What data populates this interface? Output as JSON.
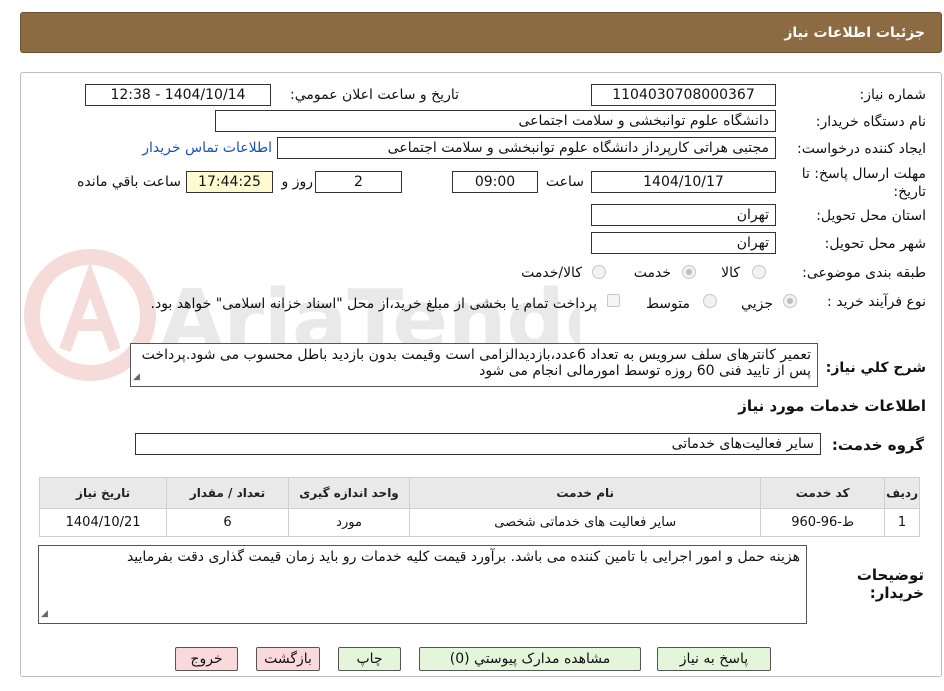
{
  "header": {
    "title": "جزئیات اطلاعات نیاز"
  },
  "form": {
    "need_number_label": "شماره نیاز:",
    "need_number": "1104030708000367",
    "announce_label": "تاریخ و ساعت اعلان عمومي:",
    "announce_value": "1404/10/14 - 12:38",
    "buyer_org_label": "نام دستگاه خریدار:",
    "buyer_org": "دانشگاه علوم توانبخشی و سلامت اجتماعی",
    "creator_label": "ایجاد کننده درخواست:",
    "creator": "مجتبی هراتی کارپرداز دانشگاه علوم توانبخشی و سلامت اجتماعی",
    "contact_link": "اطلاعات تماس خریدار",
    "deadline_label": "مهلت ارسال پاسخ: تا تاریخ:",
    "deadline_date": "1404/10/17",
    "time_label": "ساعت",
    "deadline_time": "09:00",
    "days_value": "2",
    "days_label": "روز و",
    "remaining_time": "17:44:25",
    "remaining_label": "ساعت باقي مانده",
    "province_label": "استان محل تحویل:",
    "province": "تهران",
    "city_label": "شهر محل تحویل:",
    "city": "تهران",
    "category_label": "طبقه بندی موضوعی:",
    "category_options": [
      "کالا",
      "خدمت",
      "کالا/خدمت"
    ],
    "category_selected": "خدمت",
    "process_label": "نوع فرآیند خرید :",
    "process_options": [
      "جزیي",
      "متوسط"
    ],
    "process_selected": "جزیي",
    "treasury_text": "پرداخت تمام یا بخشی از مبلغ خرید،از محل \"اسناد خزانه اسلامی\" خواهد بود.",
    "description_label": "شرح کلي نیاز:",
    "description": "تعمیر کانترهای سلف سرویس به تعداد 6عدد،بازدیدالزامی است وقیمت بدون بازدید باطل محسوب می شود.پرداخت پس از تایید فنی 60 روزه توسط امورمالی انجام می شود"
  },
  "services": {
    "section_title": "اطلاعات خدمات مورد نیاز",
    "group_label": "گروه خدمت:",
    "group_value": "سایر فعالیت‌های خدماتی",
    "columns": [
      "ردیف",
      "کد خدمت",
      "نام خدمت",
      "واحد اندازه گیری",
      "تعداد / مقدار",
      "تاریخ نیاز"
    ],
    "rows": [
      {
        "row": "1",
        "code": "ط-96-960",
        "name": "سایر فعالیت های خدماتی شخصی",
        "unit": "مورد",
        "qty": "6",
        "date": "1404/10/21"
      }
    ]
  },
  "notes": {
    "label": "توضیحات خریدار:",
    "text": "هزینه حمل و امور اجرایی با تامین کننده می باشد. برآورد قیمت کلیه خدمات رو باید زمان قیمت گذاری دقت بفرمایید"
  },
  "buttons": {
    "reply": "پاسخ به نیاز",
    "attachments": "مشاهده مدارک پیوستي (0)",
    "print": "چاپ",
    "back": "بازگشت",
    "exit": "خروج"
  },
  "watermark": {
    "text": "AriaTender.neT"
  },
  "colors": {
    "header_bg": "#8c6a42",
    "button_green": "#e3f6da",
    "button_pink": "#f9d9d9",
    "remaining_bg": "#fffbd0"
  }
}
